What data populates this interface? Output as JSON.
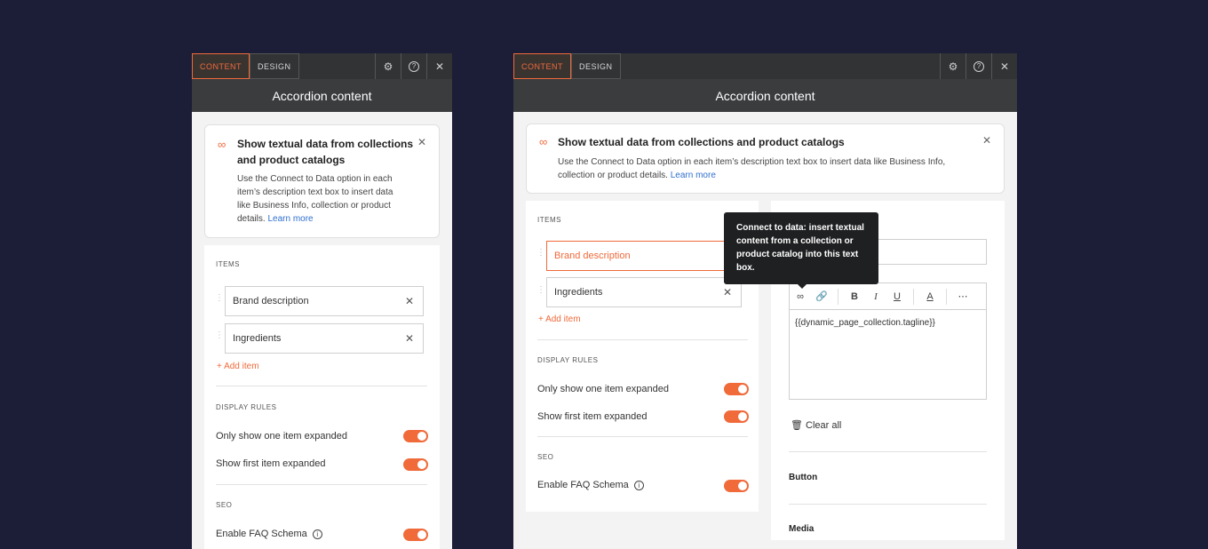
{
  "panel_left": {
    "tabs": [
      "CONTENT",
      "DESIGN"
    ],
    "title": "Accordion content",
    "banner": {
      "title_line1": "Show textual data from collections",
      "title_line2": "and product catalogs",
      "text_line1": "Use the Connect to Data option in each",
      "text_line2": "item’s description text box to insert data",
      "text_line3": "like Business Info, collection or product",
      "text_line4": "details.",
      "link": "Learn more"
    },
    "items_label": "ITEMS",
    "items": [
      "Brand description",
      "Ingredients"
    ],
    "add_item": "Add item",
    "display_rules_label": "DISPLAY RULES",
    "rule1": "Only show one item expanded",
    "rule2": "Show first item expanded",
    "seo_label": "SEO",
    "faq": "Enable FAQ Schema"
  },
  "panel_right": {
    "tabs": [
      "CONTENT",
      "DESIGN"
    ],
    "title": "Accordion content",
    "banner": {
      "title": "Show textual data from collections and product catalogs",
      "text_line1": "Use the Connect to Data option in each item’s description text box to insert data like Business Info,",
      "text_line2": "collection or product details.",
      "link": "Learn more"
    },
    "items_label": "ITEMS",
    "items": [
      "Brand description",
      "Ingredients"
    ],
    "add_item": "Add item",
    "display_rules_label": "DISPLAY RULES",
    "rule1": "Only show one item expanded",
    "rule2": "Show first item expanded",
    "seo_label": "SEO",
    "faq": "Enable FAQ Schema",
    "tooltip": "Connect to data: insert textual content from a collection or product catalog into this text box.",
    "editor_text": "{{dynamic_page_collection.tagline}}",
    "clear_all": "Clear all",
    "button_label": "Button",
    "media_label": "Media"
  },
  "colors": {
    "accent": "#f06a3a",
    "background": "#1c1d36",
    "topbar": "#313335"
  }
}
